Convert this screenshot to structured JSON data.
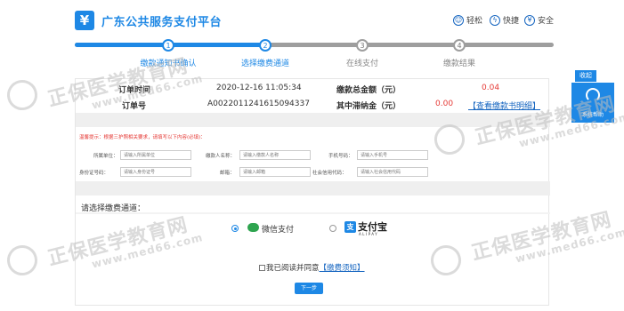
{
  "header": {
    "logo_symbol": "¥",
    "title": "广东公共服务支付平台",
    "features": [
      {
        "icon": "smile-icon",
        "label": "轻松"
      },
      {
        "icon": "lightning-icon",
        "label": "快捷"
      },
      {
        "icon": "shield-yen-icon",
        "label": "安全"
      }
    ]
  },
  "steps": [
    {
      "num": "1",
      "label": "缴款通知书确认",
      "state": "done"
    },
    {
      "num": "2",
      "label": "选择缴费通道",
      "state": "current"
    },
    {
      "num": "3",
      "label": "在线支付",
      "state": "todo"
    },
    {
      "num": "4",
      "label": "缴款结果",
      "state": "todo"
    }
  ],
  "order": {
    "time_label": "订单时间",
    "time_value": "2020-12-16 11:05:34",
    "total_label": "缴款总金额（元）",
    "total_value": "0.04",
    "id_label": "订单号",
    "id_value": "A0022011241615094337",
    "late_fee_label": "其中滞纳金（元）",
    "late_fee_value": "0.00",
    "view_notice_link": "【查看缴款书明细】"
  },
  "form": {
    "notice": "温馨提示：根据三护照相关要求，请填写以下内容(必填)：",
    "fields": [
      {
        "label": "所属单位：",
        "placeholder": "请输入所属单位"
      },
      {
        "label": "缴款人名称：",
        "placeholder": "请输入缴款人名称"
      },
      {
        "label": "手机号码：",
        "placeholder": "请输入手机号"
      },
      {
        "label": "身份证号码：",
        "placeholder": "请输入身份证号"
      },
      {
        "label": "邮箱：",
        "placeholder": "请输入邮箱"
      },
      {
        "label": "社会信用代码：",
        "placeholder": "请输入社会信用代码"
      }
    ]
  },
  "payment": {
    "choose_label": "请选择缴费通道：",
    "wechat_label": "微信支付",
    "alipay_logo": "支",
    "alipay_label": "支付宝",
    "alipay_sub": "ALIPAY",
    "selected": "wechat"
  },
  "agreement": {
    "text": "我已阅读并同意",
    "link": "【缴费须知】"
  },
  "next_button": "下一步",
  "side": {
    "collapse_label": "收起",
    "help_label": "系统帮助"
  },
  "watermark": {
    "text": "正保医学教育网",
    "url": "www.med66.com"
  },
  "colors": {
    "primary": "#1e88e5",
    "amount": "#e53935",
    "wechat": "#2ea44f"
  }
}
